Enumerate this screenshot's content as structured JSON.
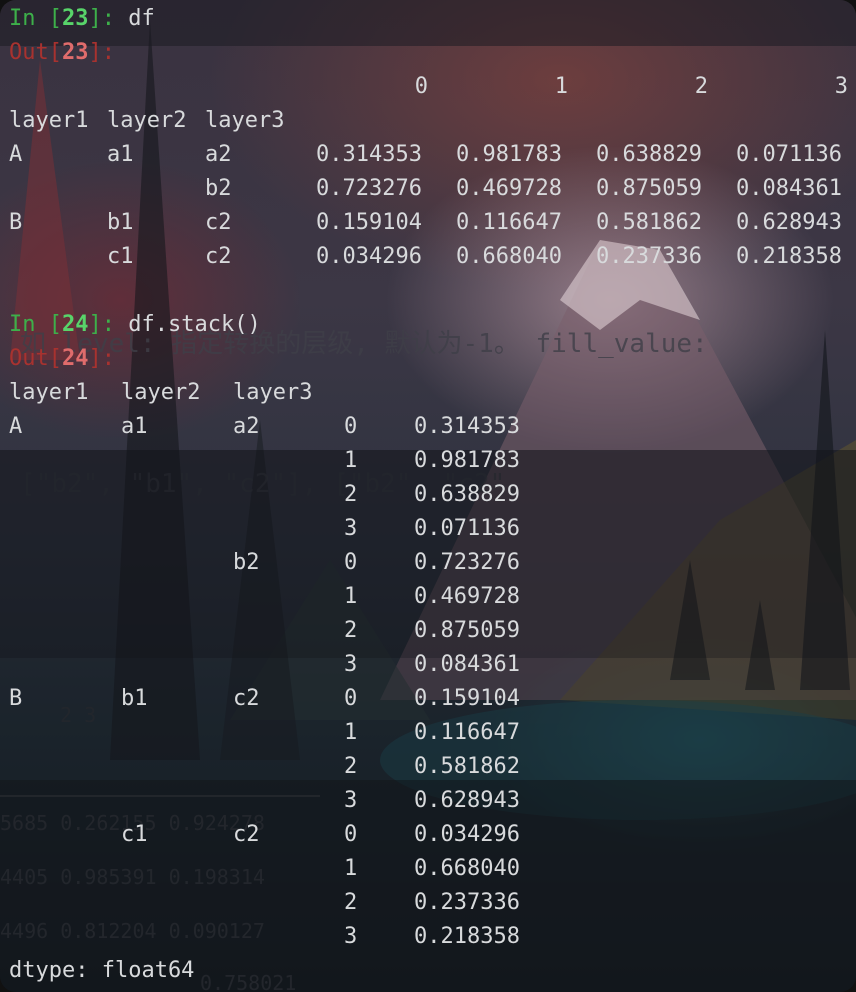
{
  "cell23": {
    "in_prefix": "In [",
    "in_num": "23",
    "in_suffix": "]: ",
    "code": "df",
    "out_prefix": "Out[",
    "out_num": "23",
    "out_suffix": "]:"
  },
  "df_table": {
    "columns": [
      "0",
      "1",
      "2",
      "3"
    ],
    "index_names": [
      "layer1",
      "layer2",
      "layer3"
    ],
    "rows": [
      {
        "l1": "A",
        "l2": "a1",
        "l3": "a2",
        "v": [
          "0.314353",
          "0.981783",
          "0.638829",
          "0.071136"
        ]
      },
      {
        "l1": "",
        "l2": "",
        "l3": "b2",
        "v": [
          "0.723276",
          "0.469728",
          "0.875059",
          "0.084361"
        ]
      },
      {
        "l1": "B",
        "l2": "b1",
        "l3": "c2",
        "v": [
          "0.159104",
          "0.116647",
          "0.581862",
          "0.628943"
        ]
      },
      {
        "l1": "",
        "l2": "c1",
        "l3": "c2",
        "v": [
          "0.034296",
          "0.668040",
          "0.237336",
          "0.218358"
        ]
      }
    ]
  },
  "cell24": {
    "in_prefix": "In [",
    "in_num": "24",
    "in_suffix": "]: ",
    "code": "df.stack()",
    "out_prefix": "Out[",
    "out_num": "24",
    "out_suffix": "]:"
  },
  "stacked": {
    "index_names": [
      "layer1",
      "layer2",
      "layer3"
    ],
    "rows": [
      {
        "l1": "A",
        "l2": "a1",
        "l3": "a2",
        "k": "0",
        "v": "0.314353"
      },
      {
        "l1": "",
        "l2": "",
        "l3": "",
        "k": "1",
        "v": "0.981783"
      },
      {
        "l1": "",
        "l2": "",
        "l3": "",
        "k": "2",
        "v": "0.638829"
      },
      {
        "l1": "",
        "l2": "",
        "l3": "",
        "k": "3",
        "v": "0.071136"
      },
      {
        "l1": "",
        "l2": "",
        "l3": "b2",
        "k": "0",
        "v": "0.723276"
      },
      {
        "l1": "",
        "l2": "",
        "l3": "",
        "k": "1",
        "v": "0.469728"
      },
      {
        "l1": "",
        "l2": "",
        "l3": "",
        "k": "2",
        "v": "0.875059"
      },
      {
        "l1": "",
        "l2": "",
        "l3": "",
        "k": "3",
        "v": "0.084361"
      },
      {
        "l1": "B",
        "l2": "b1",
        "l3": "c2",
        "k": "0",
        "v": "0.159104"
      },
      {
        "l1": "",
        "l2": "",
        "l3": "",
        "k": "1",
        "v": "0.116647"
      },
      {
        "l1": "",
        "l2": "",
        "l3": "",
        "k": "2",
        "v": "0.581862"
      },
      {
        "l1": "",
        "l2": "",
        "l3": "",
        "k": "3",
        "v": "0.628943"
      },
      {
        "l1": "",
        "l2": "c1",
        "l3": "c2",
        "k": "0",
        "v": "0.034296"
      },
      {
        "l1": "",
        "l2": "",
        "l3": "",
        "k": "1",
        "v": "0.668040"
      },
      {
        "l1": "",
        "l2": "",
        "l3": "",
        "k": "2",
        "v": "0.237336"
      },
      {
        "l1": "",
        "l2": "",
        "l3": "",
        "k": "3",
        "v": "0.218358"
      }
    ],
    "dtype": "dtype: float64"
  },
  "colors": {
    "prompt_in": "#3db04a",
    "prompt_in_num": "#58d46a",
    "prompt_out": "#a8322f",
    "prompt_out_num": "#e06c6c",
    "text": "#d8dadc"
  }
}
